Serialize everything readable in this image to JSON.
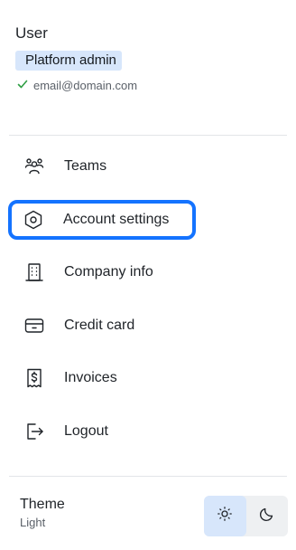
{
  "user": {
    "name": "User",
    "role": "Platform admin",
    "email": "email@domain.com",
    "email_verified_icon": "check-icon"
  },
  "menu": {
    "items": [
      {
        "label": "Teams",
        "icon": "users-group-icon"
      },
      {
        "label": "Account settings",
        "icon": "hexagon-settings-icon"
      },
      {
        "label": "Company info",
        "icon": "building-icon"
      },
      {
        "label": "Credit card",
        "icon": "credit-card-icon"
      },
      {
        "label": "Invoices",
        "icon": "receipt-dollar-icon"
      },
      {
        "label": "Logout",
        "icon": "logout-icon"
      }
    ],
    "focused_item": "Account settings"
  },
  "theme": {
    "title": "Theme",
    "value": "Light",
    "options": [
      "light",
      "dark"
    ],
    "selected": "light"
  },
  "colors": {
    "accent": "#1473ff",
    "badge_bg": "#d7e6fb",
    "check": "#2f9e44"
  }
}
